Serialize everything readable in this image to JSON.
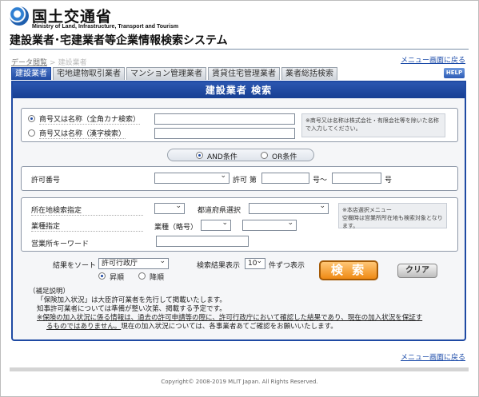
{
  "header": {
    "ministry_jp": "国土交通省",
    "ministry_en": "Ministry of Land, Infrastructure, Transport and Tourism",
    "system_title": "建設業者･宅建業者等企業情報検索システム"
  },
  "breadcrumb": {
    "item1": "データ閲覧",
    "separator": ">",
    "item2": "建設業者"
  },
  "menu_link": "メニュー画面に戻る",
  "tabs": [
    {
      "label": "建設業者"
    },
    {
      "label": "宅地建物取引業者"
    },
    {
      "label": "マンション管理業者"
    },
    {
      "label": "賃貸住宅管理業者"
    },
    {
      "label": "業者総括検索"
    }
  ],
  "help_label": "HELP",
  "panel_title": "建設業者 検索",
  "name_search": {
    "kana_label": "商号又は名称（全角カナ検索）",
    "kanji_label": "商号又は名称（漢字検索）",
    "kana_value": "",
    "kanji_value": "",
    "note": "※商号又は名称は株式会社・有限会社等を除いた名称で入力してください。"
  },
  "condition": {
    "and_label": "AND条件",
    "or_label": "OR条件",
    "selected": "AND"
  },
  "license": {
    "label": "許可番号",
    "prefix": "許可 第",
    "middle": "号〜",
    "suffix": "号",
    "select_value": "",
    "from_value": "",
    "to_value": ""
  },
  "location": {
    "label": "所在地検索指定",
    "pref_label": "都道府県選択",
    "loc_select": "",
    "pref_select": "",
    "note_line1": "※本店選択メニュー",
    "note_line2": "空欄時は営業所所在地も検索対象となります。"
  },
  "industry": {
    "label": "業種指定",
    "abbr_label": "業種（略号）",
    "select1": "",
    "select2": ""
  },
  "office_keyword": {
    "label": "営業所キーワード",
    "value": ""
  },
  "sort": {
    "label": "結果をソート",
    "value": "許可行政庁",
    "asc": "昇順",
    "desc": "降順",
    "selected": "asc"
  },
  "display": {
    "label": "検索結果表示",
    "count": "10",
    "unit": "件ずつ表示"
  },
  "buttons": {
    "search": "検 索",
    "clear": "クリア"
  },
  "notes": {
    "heading": "（補足説明）",
    "line1": "「保険加入状況」は大臣許可業者を先行して掲載いたします。",
    "line2": "知事許可業者については準備が整い次第、掲載する予定です。",
    "line3a": "※保険の加入状況に係る情報は、過去の許可申請等の際に、許可行政庁において確認した結果であり、現在の加入状況を保証す",
    "line3b": "るものではありません。",
    "line3c": "現在の加入状況については、各事業者あてご確認をお願いいたします。"
  },
  "copyright": "Copyright© 2008-2019 MLIT Japan. All Rights Reserved."
}
